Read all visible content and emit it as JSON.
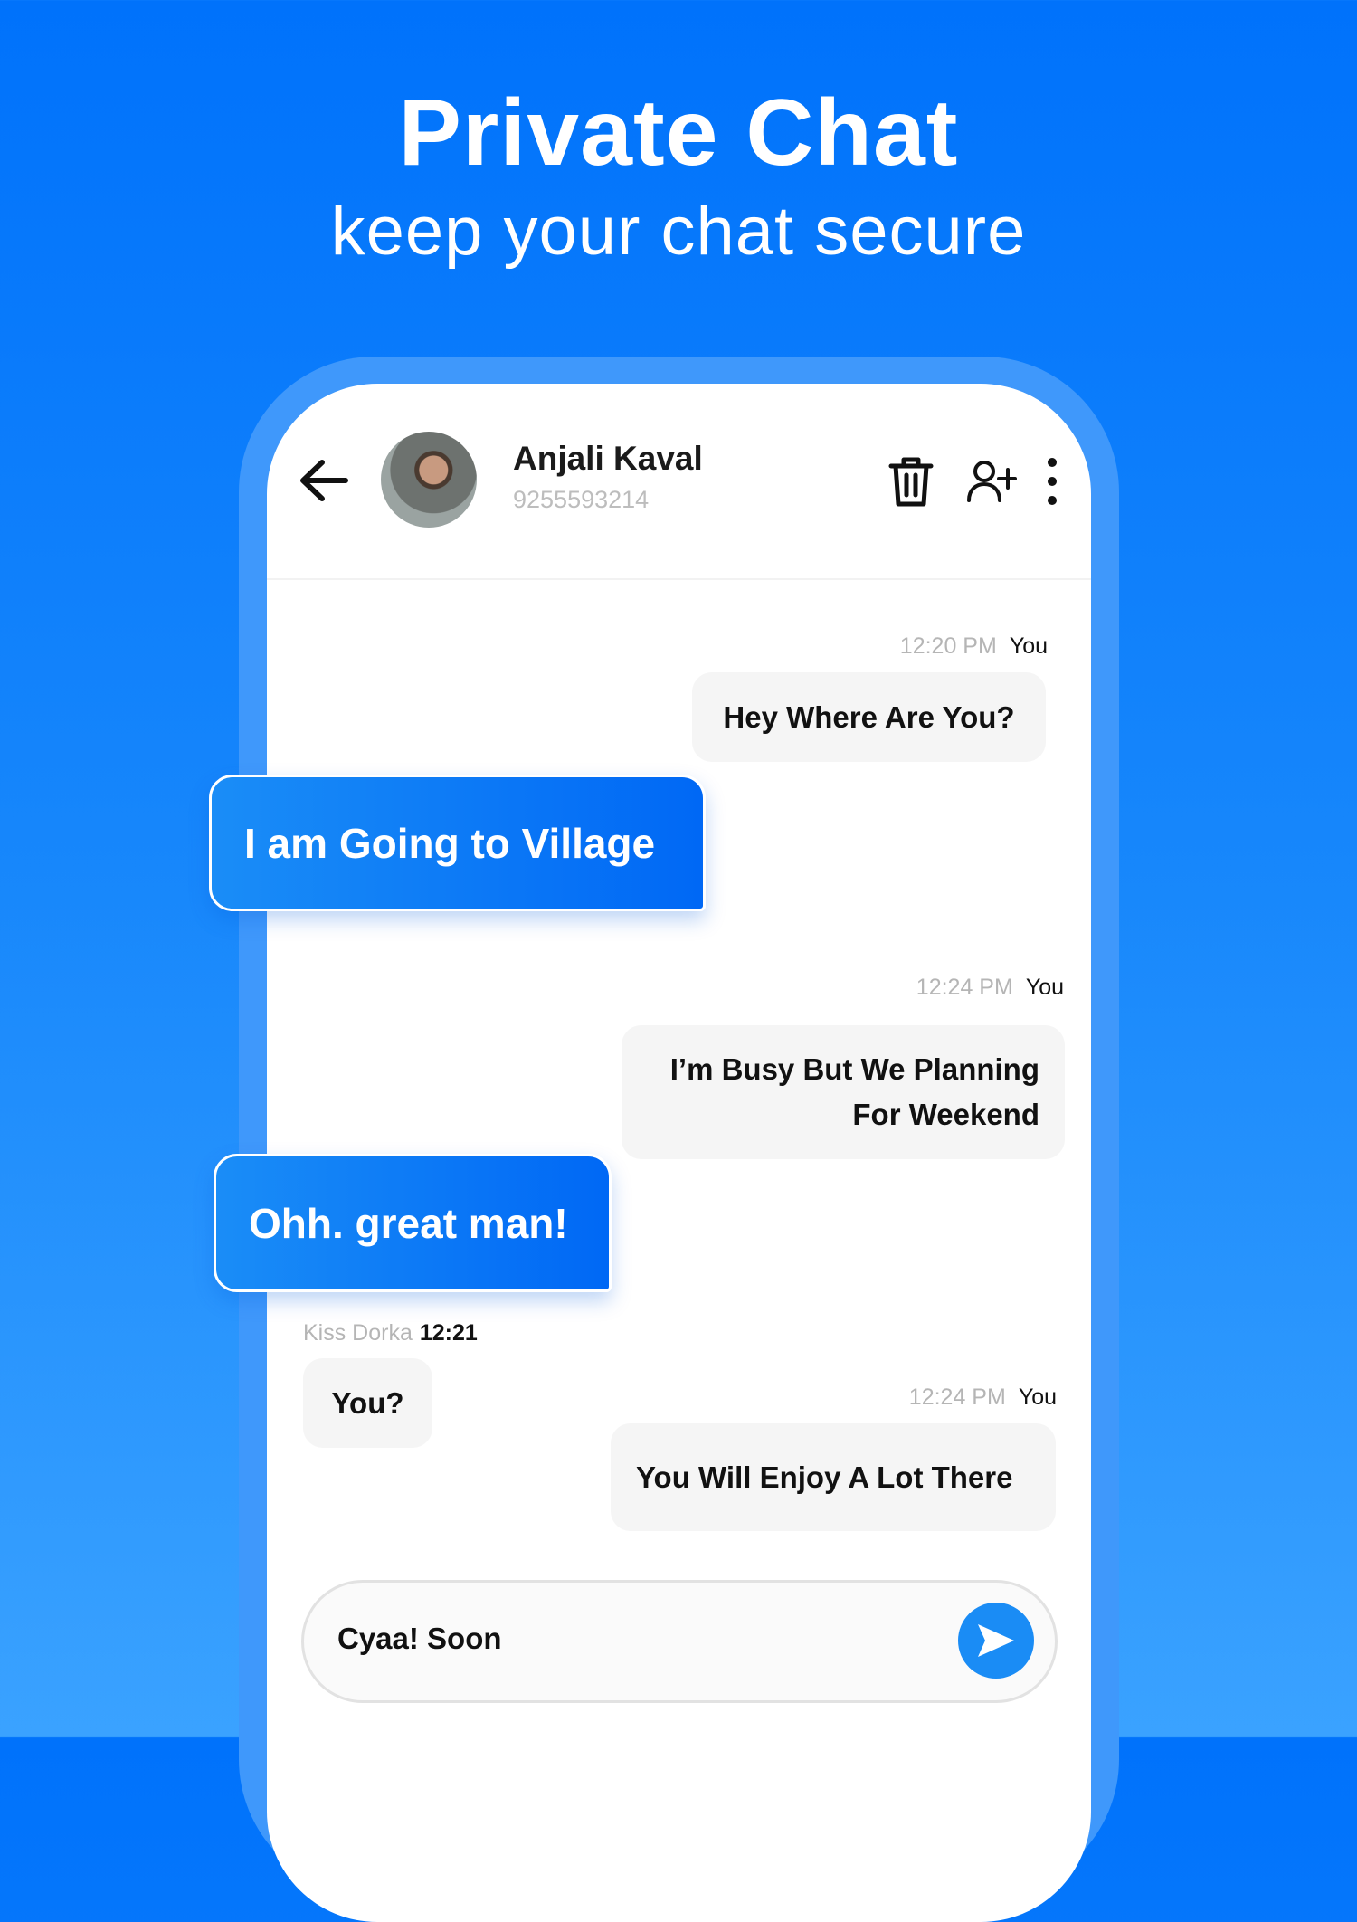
{
  "promo": {
    "title": "Private Chat",
    "subtitle": "keep your chat secure"
  },
  "header": {
    "contact_name": "Anjali Kaval",
    "contact_phone": "9255593214",
    "icons": [
      "back-arrow-icon",
      "trash-icon",
      "add-user-icon",
      "more-vertical-icon"
    ]
  },
  "messages": [
    {
      "time": "12:20 PM",
      "sender": "You",
      "text": "Hey Where Are You?"
    },
    {
      "text": "I am Going to Village",
      "highlighted": true
    },
    {
      "time": "12:24 PM",
      "sender": "You",
      "text_line1": "I’m Busy But We Planning",
      "text_line2": "For Weekend"
    },
    {
      "text": "Ohh. great man!",
      "highlighted": true
    },
    {
      "sender": "Kiss Dorka",
      "time": "12:21",
      "text": "You?"
    },
    {
      "time": "12:24 PM",
      "sender": "You",
      "text": "You Will Enjoy A Lot There"
    }
  ],
  "composer": {
    "value": "Cyaa! Soon",
    "send_icon": "send-icon"
  },
  "colors": {
    "accent": "#1a8cf5",
    "background_top": "#0072fb",
    "background_bottom": "#3aa2ff"
  }
}
